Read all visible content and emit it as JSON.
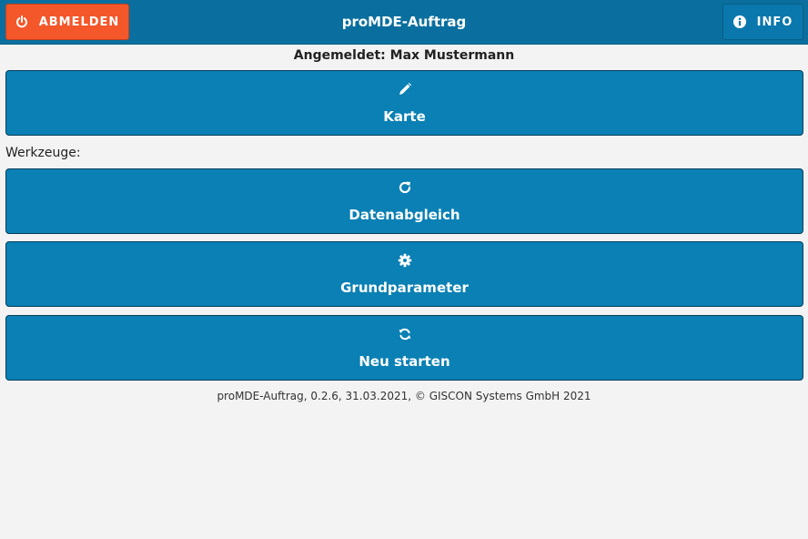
{
  "header": {
    "title": "proMDE-Auftrag",
    "logout_label": "ABMELDEN",
    "info_label": "INFO"
  },
  "status": {
    "logged_in": "Angemeldet: Max Mustermann"
  },
  "main_tile": {
    "label": "Karte",
    "icon": "pencil-icon"
  },
  "tools": {
    "section_label": "Werkzeuge:",
    "items": [
      {
        "label": "Datenabgleich",
        "icon": "refresh-icon"
      },
      {
        "label": "Grundparameter",
        "icon": "gear-icon"
      },
      {
        "label": "Neu starten",
        "icon": "restart-icon"
      }
    ]
  },
  "footer": {
    "text": "proMDE-Auftrag, 0.2.6, 31.03.2021, © GISCON Systems GmbH 2021"
  },
  "colors": {
    "header": "#0a6f9e",
    "logout": "#f4572a",
    "tile": "#0a80b4",
    "background": "#f3f3f3"
  }
}
